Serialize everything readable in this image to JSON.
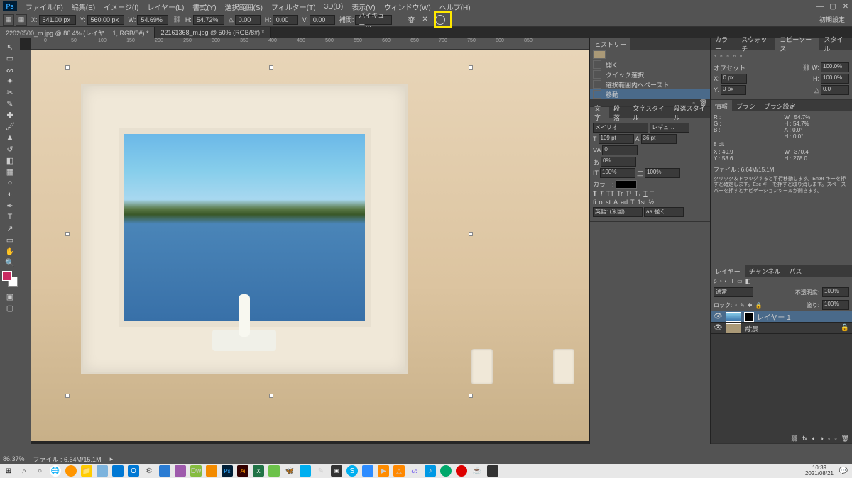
{
  "menu": [
    "ファイル(F)",
    "編集(E)",
    "イメージ(I)",
    "レイヤー(L)",
    "書式(Y)",
    "選択範囲(S)",
    "フィルター(T)",
    "3D(D)",
    "表示(V)",
    "ウィンドウ(W)",
    "ヘルプ(H)"
  ],
  "options": {
    "x": "641.00 px",
    "y": "560.00 px",
    "w": "54.69%",
    "h": "54.72%",
    "angle": "0.00",
    "hskew": "0.00",
    "vskew": "0.00",
    "interp_lbl": "補間:",
    "interp": "バイキュー…",
    "right": "初期設定"
  },
  "tabs": [
    "22026500_m.jpg @ 86.4% (レイヤー 1, RGB/8#) *",
    "22161368_m.jpg @ 50% (RGB/8#) *"
  ],
  "ruler_marks": [
    "0",
    "50",
    "100",
    "150",
    "200",
    "250",
    "300",
    "350",
    "400",
    "450",
    "500",
    "550",
    "600",
    "650",
    "700",
    "750",
    "800",
    "850"
  ],
  "history": {
    "title": "ヒストリー",
    "items": [
      "開く",
      "クイック選択",
      "選択範囲内へペースト",
      "移動"
    ]
  },
  "char_panel": {
    "tabs": [
      "文字",
      "段落",
      "文字スタイル",
      "段落スタイル"
    ],
    "font": "メイリオ",
    "style": "レギュ…",
    "size": "109 pt",
    "leading": "36 pt",
    "tracking": "0",
    "kerning": "0%",
    "vscale": "100%",
    "hscale": "100%",
    "color_lbl": "カラー:",
    "aa_lbl": "英語:",
    "aa_val": "(米国)",
    "aa2": "aa 強く"
  },
  "right_tabs": {
    "row1": [
      "カラー",
      "スウォッチ",
      "コピーソース",
      "スタイル"
    ],
    "row2": [
      "情報",
      "ブラシ",
      "ブラシ設定"
    ],
    "row3": [
      "レイヤー",
      "チャンネル",
      "パス"
    ]
  },
  "copy_source": {
    "offset_lbl": "オフセット:",
    "x_lbl": "X:",
    "x_val": "0 px",
    "y_lbl": "Y:",
    "y_val": "0 px",
    "w_lbl": "W:",
    "w_val": "100.0%",
    "h_lbl": "H:",
    "h_val": "100.0%",
    "angle_lbl": "△",
    "angle_val": "0.0"
  },
  "info": {
    "r": "R :",
    "g": "G :",
    "b": "B :",
    "bit": "8 bit",
    "x_lbl": "X :",
    "x_val": "40.9",
    "y_lbl": "Y :",
    "y_val": "58.6",
    "w_lbl": "W :",
    "w_val": "370.4",
    "h_lbl": "H :",
    "h_val": "278.0",
    "w2_lbl": "W :",
    "w2_val": "54.7%",
    "h2_lbl": "H :",
    "h2_val": "54.7%",
    "a_lbl": "A :",
    "a_val": "0.0°",
    "h3_lbl": "H :",
    "h3_val": "0.0°",
    "doc": "ファイル : 6.64M/15.1M",
    "hint": "クリック＆ドラッグすると平行移動します。Enter キーを押すと確定します。Esc キーを押すと取り消します。スペースバーを押すとナビゲーションツールが開きます。"
  },
  "layers": {
    "blend": "通常",
    "opacity_lbl": "不透明度:",
    "opacity": "100%",
    "lock_lbl": "ロック:",
    "fill_lbl": "塗り:",
    "fill": "100%",
    "items": [
      "レイヤー 1",
      "背景"
    ]
  },
  "status": {
    "zoom": "86.37%",
    "doc": "ファイル : 6.64M/15.1M"
  },
  "clock": {
    "time": "10:39",
    "date": "2021/08/21"
  },
  "stop": "止"
}
